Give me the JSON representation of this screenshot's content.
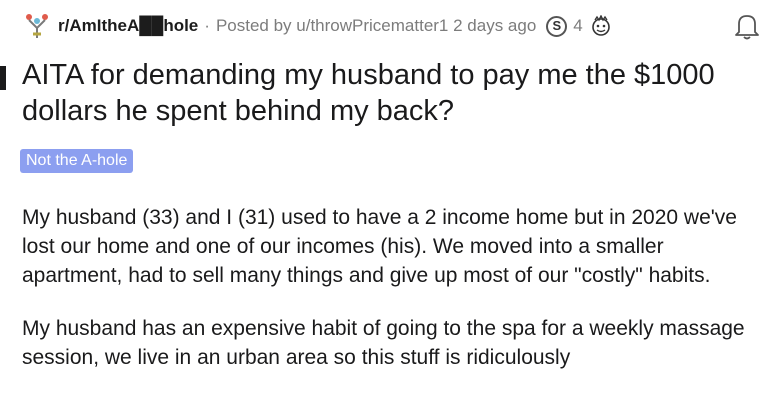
{
  "post": {
    "subreddit": "r/AmItheA██hole",
    "separator": "·",
    "posted_by": "Posted by u/throwPricematter1 2 days ago",
    "award_silver_label": "S",
    "award_count": "4",
    "title": "AITA for demanding my husband to pay me the $1000 dollars he spent behind my back?",
    "flair": "Not the A-hole",
    "paragraphs": [
      "My husband (33) and I (31) used to have a 2 income home but in 2020 we've lost our home and one of our incomes (his). We moved into a smaller apartment, had to sell many things and give up most of our \"costly\" habits.",
      "My husband has an expensive habit of going to the spa for a weekly massage session, we live in an urban area so this stuff is ridiculously"
    ]
  },
  "icons": {
    "subreddit": "subreddit-icon",
    "award": "award-face-icon",
    "notification": "bell-icon"
  },
  "colors": {
    "flair_bg": "#8c9ff0",
    "meta_gray": "#7c7c7c",
    "text": "#1a1a1b"
  }
}
